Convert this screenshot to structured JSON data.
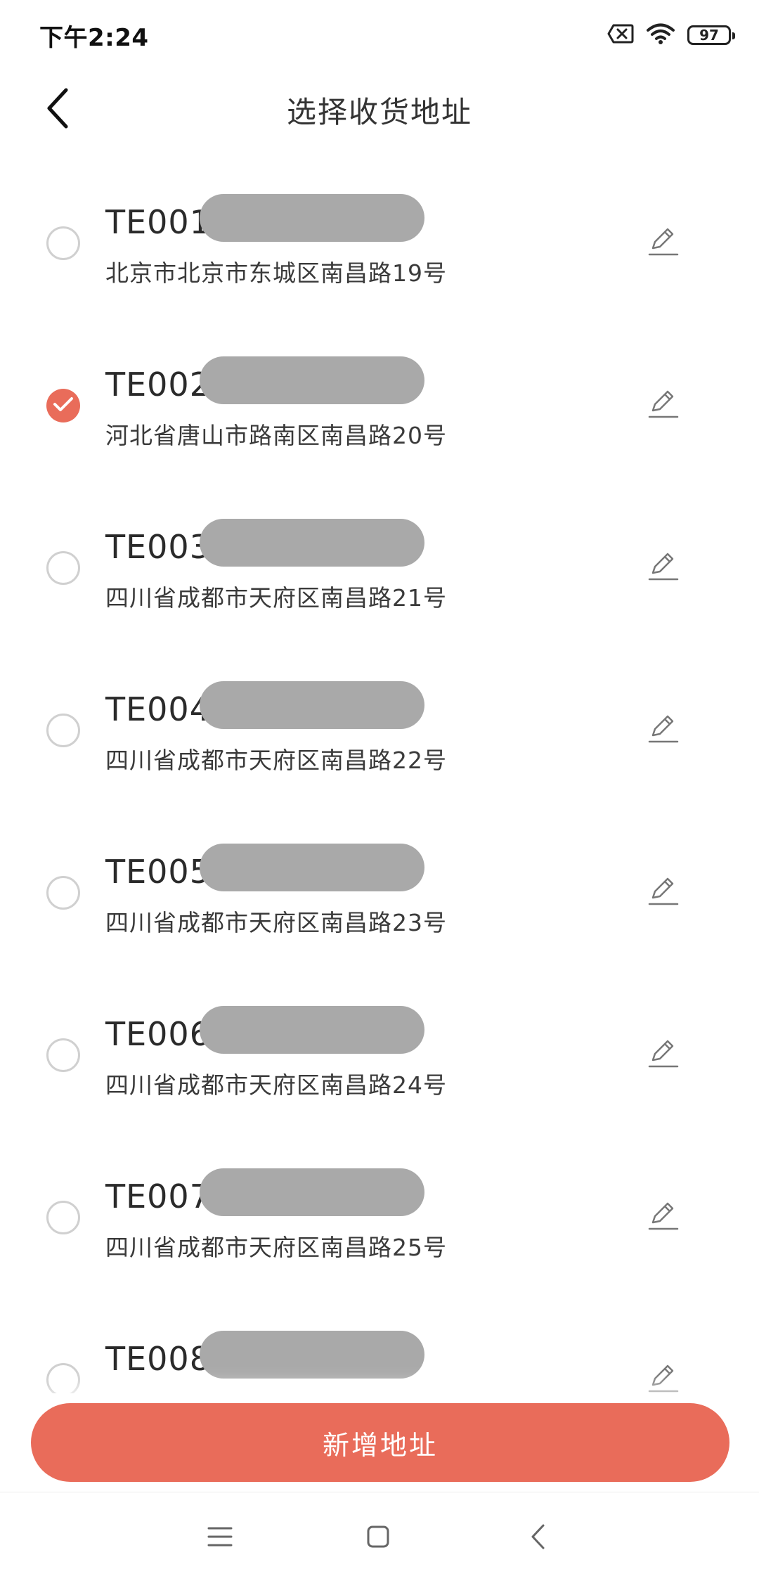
{
  "status_bar": {
    "time": "下午2:24",
    "battery": "97",
    "icons": [
      "sim-off-icon",
      "wifi-icon",
      "battery-icon"
    ]
  },
  "header": {
    "title": "选择收货地址",
    "back_icon": "chevron-left-icon"
  },
  "addresses": [
    {
      "name": "TE001",
      "address": "北京市北京市东城区南昌路19号",
      "selected": false
    },
    {
      "name": "TE002",
      "address": "河北省唐山市路南区南昌路20号",
      "selected": true
    },
    {
      "name": "TE003",
      "address": "四川省成都市天府区南昌路21号",
      "selected": false
    },
    {
      "name": "TE004",
      "address": "四川省成都市天府区南昌路22号",
      "selected": false
    },
    {
      "name": "TE005",
      "address": "四川省成都市天府区南昌路23号",
      "selected": false
    },
    {
      "name": "TE006",
      "address": "四川省成都市天府区南昌路24号",
      "selected": false
    },
    {
      "name": "TE007",
      "address": "四川省成都市天府区南昌路25号",
      "selected": false
    },
    {
      "name": "TE008",
      "address": "",
      "selected": false
    }
  ],
  "add_button": {
    "label": "新增地址"
  },
  "nav_bar": {
    "icons": [
      "menu-icon",
      "home-icon",
      "back-icon"
    ]
  },
  "colors": {
    "accent": "#e96c5a",
    "redaction": "#a9a9a9",
    "radio_border": "#d0d0d0"
  }
}
